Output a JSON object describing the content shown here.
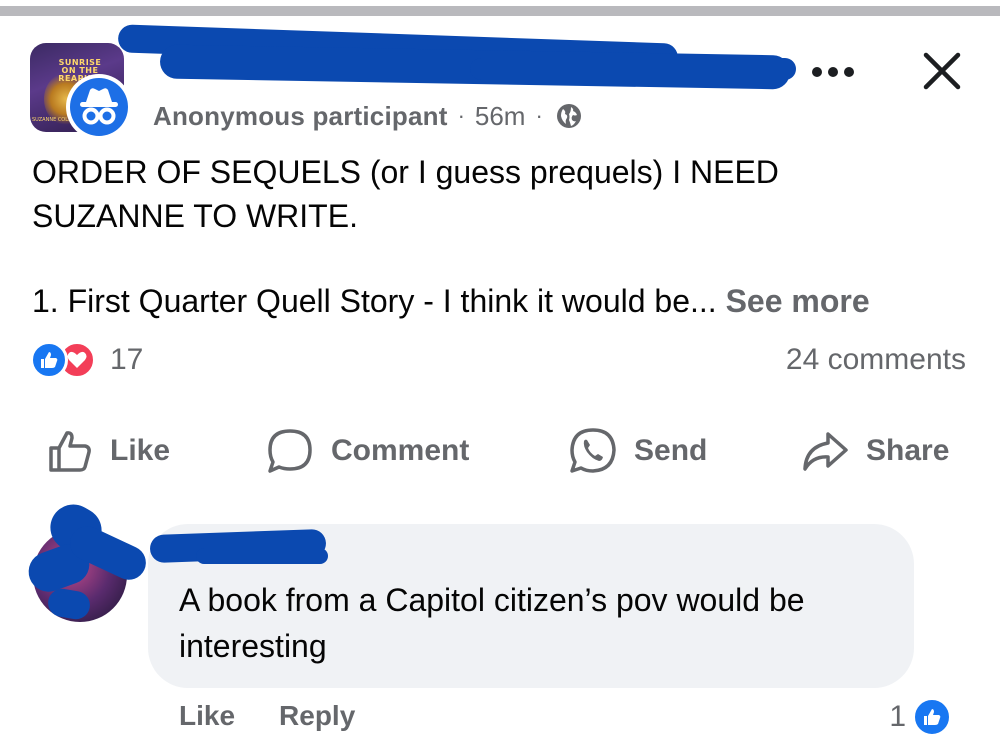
{
  "group": {
    "avatar_title": "SUNRISE ON THE REAPING",
    "avatar_subtitle": "SUZANNE COLLINS"
  },
  "post": {
    "author": "Anonymous participant",
    "separator": "·",
    "time": "56m",
    "privacy_icon": "globe-icon",
    "text_line1": "ORDER OF SEQUELS (or I guess prequels) I NEED",
    "text_line2": "SUZANNE TO WRITE.",
    "text_line3": "1. First Quarter Quell Story - I think it would be...",
    "see_more": "See more",
    "reaction_count": "17",
    "comments_count": "24 comments"
  },
  "actions": {
    "like": "Like",
    "comment": "Comment",
    "send": "Send",
    "share": "Share"
  },
  "comment": {
    "text": "A book from a Capitol citizen’s pov would be interesting",
    "like": "Like",
    "reply": "Reply",
    "reaction_count": "1"
  },
  "colors": {
    "brand_blue": "#1877f2",
    "love_red": "#f33e58",
    "secondary_text": "#65676b",
    "bubble_bg": "#f0f2f5",
    "redaction": "#0b49b0"
  }
}
